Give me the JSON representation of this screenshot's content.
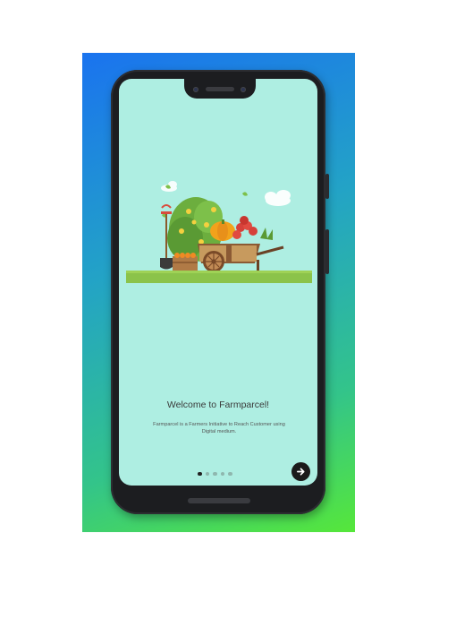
{
  "onboarding": {
    "title": "Welcome to Farmparcel!",
    "description": "Farmparcel is a Farmers Initiative to Reach Customer using Digital medium.",
    "page_indicator": {
      "total": 5,
      "active": 1
    },
    "next_icon": "arrow-right-icon"
  },
  "colors": {
    "screen_bg": "#aeeee2",
    "promo_gradient": [
      "#1a73ef",
      "#56e73a"
    ],
    "phone_frame": "#1c1d20",
    "next_button": "#1a1a1a"
  }
}
